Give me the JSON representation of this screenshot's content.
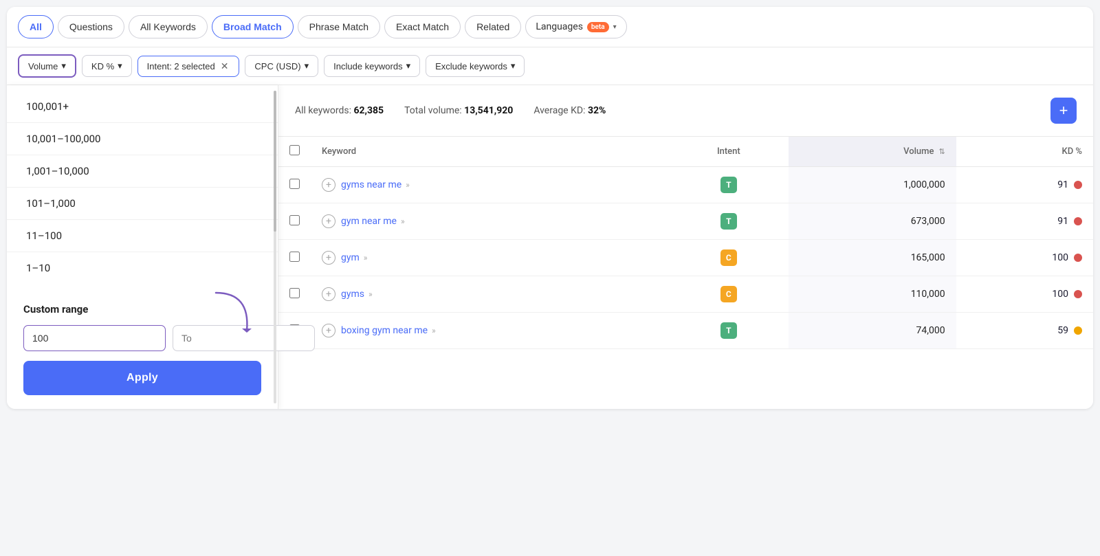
{
  "tabs": [
    {
      "id": "all",
      "label": "All",
      "active": true
    },
    {
      "id": "questions",
      "label": "Questions",
      "active": false
    },
    {
      "id": "all-keywords",
      "label": "All Keywords",
      "active": false
    },
    {
      "id": "broad-match",
      "label": "Broad Match",
      "active": true
    },
    {
      "id": "phrase-match",
      "label": "Phrase Match",
      "active": false
    },
    {
      "id": "exact-match",
      "label": "Exact Match",
      "active": false
    },
    {
      "id": "related",
      "label": "Related",
      "active": false
    }
  ],
  "languages_tab": {
    "label": "Languages",
    "badge": "beta"
  },
  "filters": {
    "volume": {
      "label": "Volume",
      "active": true
    },
    "kd": {
      "label": "KD %"
    },
    "intent": {
      "label": "Intent: 2 selected",
      "active": true
    },
    "cpc": {
      "label": "CPC (USD)"
    },
    "include": {
      "label": "Include keywords"
    },
    "exclude": {
      "label": "Exclude keywords"
    }
  },
  "dropdown": {
    "options": [
      {
        "label": "100,001+"
      },
      {
        "label": "10,001–100,000"
      },
      {
        "label": "1,001–10,000"
      },
      {
        "label": "101–1,000"
      },
      {
        "label": "11–100"
      },
      {
        "label": "1–10"
      }
    ],
    "custom_range_label": "Custom range",
    "from_placeholder": "100",
    "from_value": "100",
    "to_placeholder": "To",
    "apply_label": "Apply"
  },
  "stats": {
    "all_keywords_label": "All keywords:",
    "all_keywords_value": "62,385",
    "total_volume_label": "Total volume:",
    "total_volume_value": "13,541,920",
    "avg_kd_label": "Average KD:",
    "avg_kd_value": "32%"
  },
  "add_button_label": "+",
  "table": {
    "columns": [
      {
        "id": "keyword",
        "label": "Keyword"
      },
      {
        "id": "intent",
        "label": "Intent"
      },
      {
        "id": "volume",
        "label": "Volume"
      },
      {
        "id": "kd",
        "label": "KD %"
      }
    ],
    "rows": [
      {
        "keyword": "gyms near me",
        "intent": "T",
        "intent_type": "t",
        "volume": "1,000,000",
        "kd": "91",
        "kd_color": "red"
      },
      {
        "keyword": "gym near me",
        "intent": "T",
        "intent_type": "t",
        "volume": "673,000",
        "kd": "91",
        "kd_color": "red"
      },
      {
        "keyword": "gym",
        "intent": "C",
        "intent_type": "c",
        "volume": "165,000",
        "kd": "100",
        "kd_color": "red"
      },
      {
        "keyword": "gyms",
        "intent": "C",
        "intent_type": "c",
        "volume": "110,000",
        "kd": "100",
        "kd_color": "red"
      },
      {
        "keyword": "boxing gym near me",
        "intent": "T",
        "intent_type": "t",
        "volume": "74,000",
        "kd": "59",
        "kd_color": "orange"
      }
    ]
  }
}
